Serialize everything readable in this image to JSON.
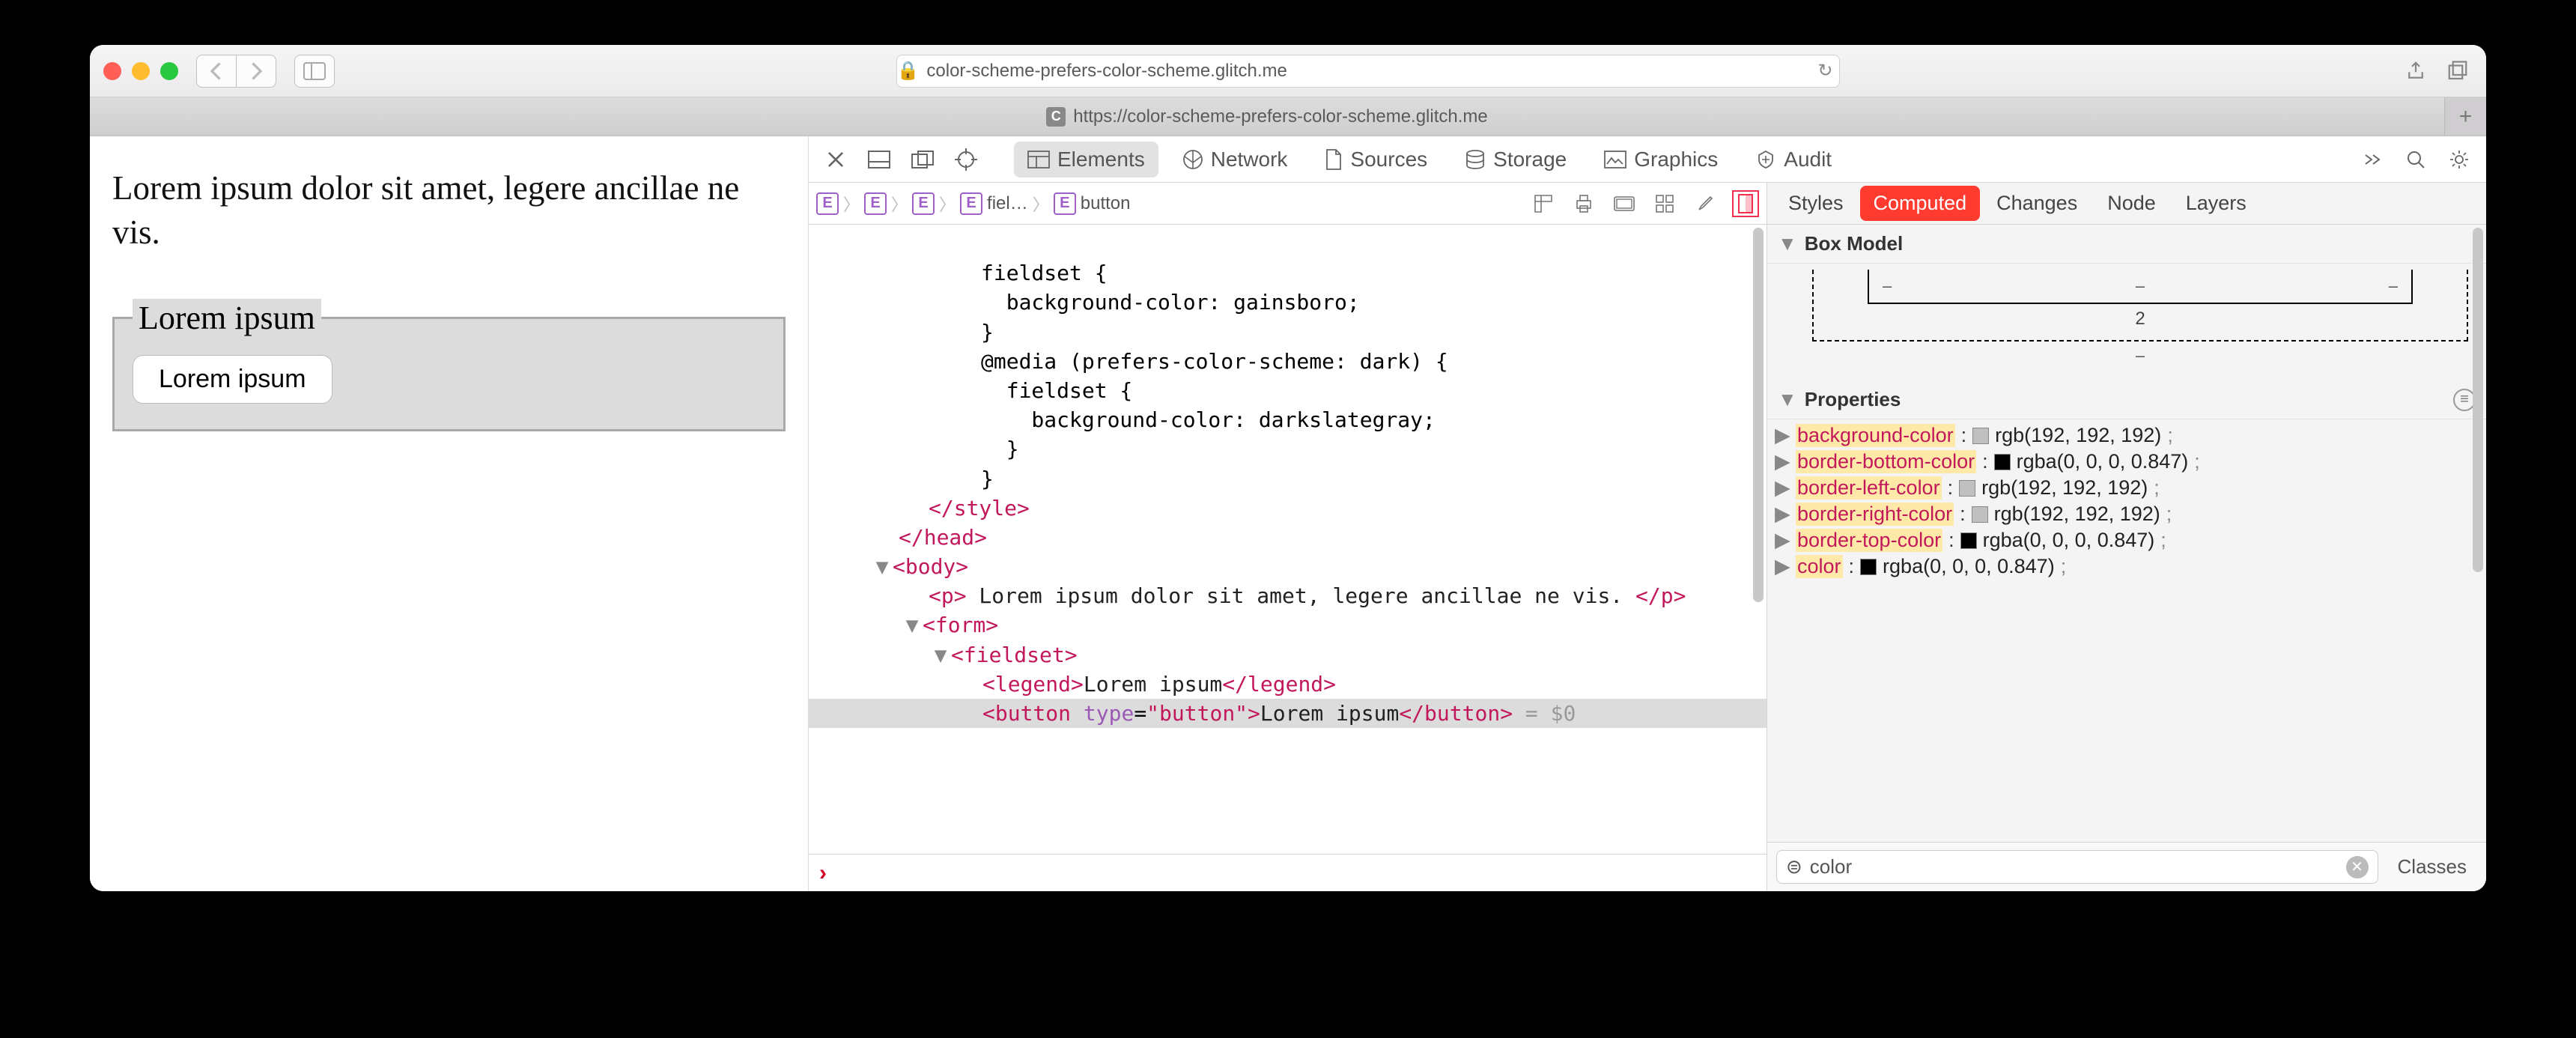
{
  "browser": {
    "url_display": "color-scheme-prefers-color-scheme.glitch.me",
    "tab_title": "https://color-scheme-prefers-color-scheme.glitch.me",
    "tab_favicon_letter": "C"
  },
  "page": {
    "paragraph": "Lorem ipsum dolor sit amet, legere ancillae ne vis.",
    "legend": "Lorem ipsum",
    "button_label": "Lorem ipsum"
  },
  "devtools": {
    "tabs": {
      "elements": "Elements",
      "network": "Network",
      "sources": "Sources",
      "storage": "Storage",
      "graphics": "Graphics",
      "audit": "Audit"
    },
    "breadcrumb": {
      "item3": "fiel…",
      "item4": "button"
    },
    "dom": {
      "l1": "fieldset {",
      "l2": "  background-color: gainsboro;",
      "l3": "}",
      "l4": "@media (prefers-color-scheme: dark) {",
      "l5": "  fieldset {",
      "l6": "    background-color: darkslategray;",
      "l7": "  }",
      "l8": "}",
      "style_close": "</style>",
      "head_close": "</head>",
      "body_open": "<body>",
      "p_open": "<p>",
      "p_text": " Lorem ipsum dolor sit amet, legere ancillae ne vis. ",
      "p_close": "</p>",
      "form_open": "<form>",
      "fieldset_open": "<fieldset>",
      "legend_open": "<legend>",
      "legend_text": "Lorem ipsum",
      "legend_close": "</legend>",
      "button_open_tag": "<button",
      "button_attr_name": " type",
      "button_attr_eq": "=",
      "button_attr_val": "\"button\"",
      "button_open_end": ">",
      "button_text": "Lorem ipsum",
      "button_close": "</button>",
      "eq0": " = $0"
    },
    "styles_tabs": {
      "styles": "Styles",
      "computed": "Computed",
      "changes": "Changes",
      "node": "Node",
      "layers": "Layers"
    },
    "box_model": {
      "heading": "Box Model",
      "dash": "–",
      "value": "2"
    },
    "properties": {
      "heading": "Properties",
      "rows": [
        {
          "name": "background-color",
          "swatch": "#c0c0c0",
          "value": "rgb(192, 192, 192)"
        },
        {
          "name": "border-bottom-color",
          "swatch": "#000000",
          "value": "rgba(0, 0, 0, 0.847)"
        },
        {
          "name": "border-left-color",
          "swatch": "#c0c0c0",
          "value": "rgb(192, 192, 192)"
        },
        {
          "name": "border-right-color",
          "swatch": "#c0c0c0",
          "value": "rgb(192, 192, 192)"
        },
        {
          "name": "border-top-color",
          "swatch": "#000000",
          "value": "rgba(0, 0, 0, 0.847)"
        },
        {
          "name": "color",
          "swatch": "#000000",
          "value": "rgba(0, 0, 0, 0.847)"
        }
      ]
    },
    "filter": {
      "value": "color",
      "classes_btn": "Classes"
    }
  }
}
